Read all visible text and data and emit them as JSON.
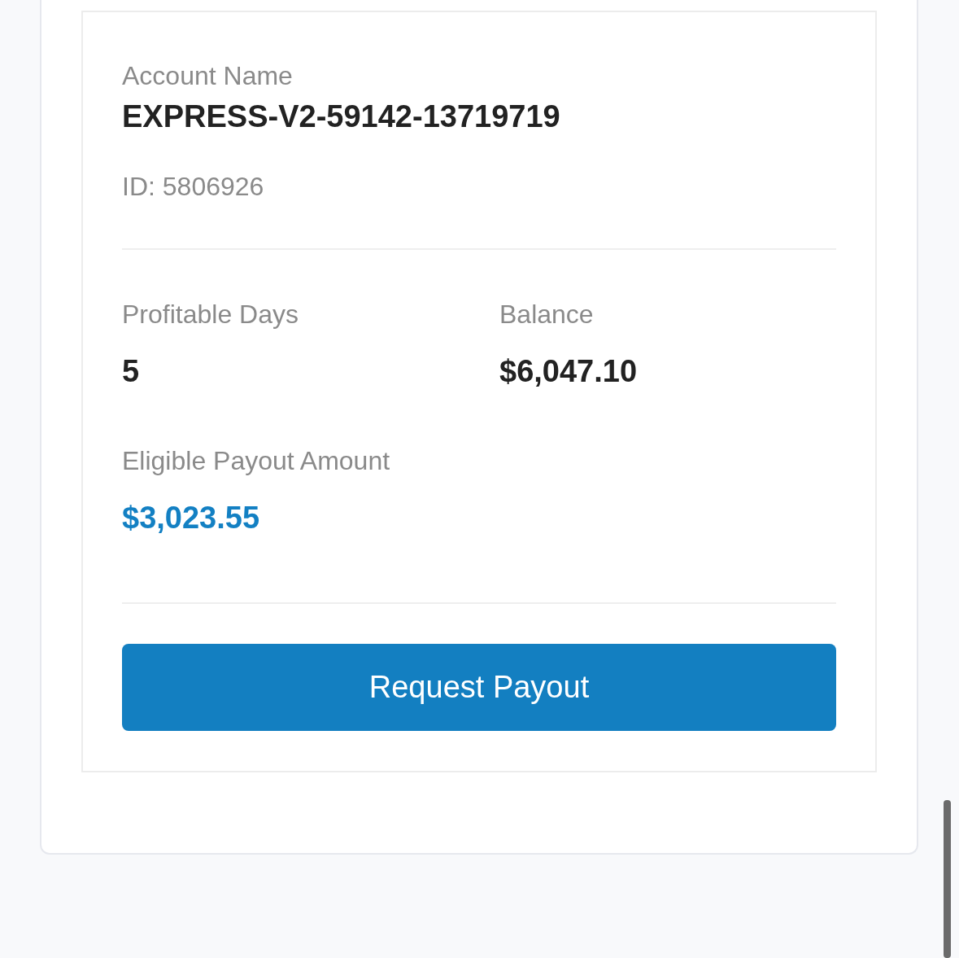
{
  "account": {
    "label": "Account Name",
    "name": "EXPRESS-V2-59142-13719719",
    "id": "ID: 5806926"
  },
  "stats": [
    {
      "label": "Profitable Days",
      "value": "5",
      "kind": "plain"
    },
    {
      "label": "Balance",
      "value": "$6,047.10",
      "kind": "plain"
    },
    {
      "label": "Eligible Payout Amount",
      "value": "$3,023.55",
      "kind": "highlight"
    }
  ],
  "button": {
    "label": "Request Payout"
  }
}
